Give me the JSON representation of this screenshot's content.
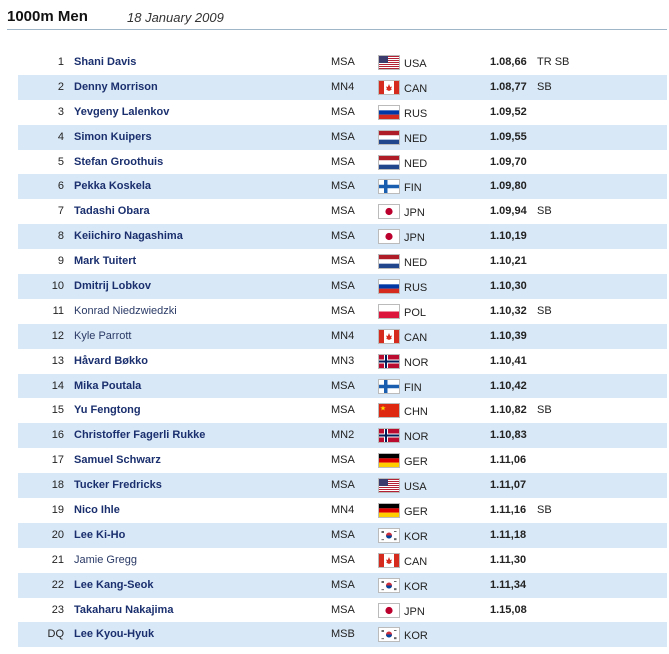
{
  "header": {
    "title": "1000m Men",
    "date": "18 January 2009"
  },
  "results": [
    {
      "rank": "1",
      "name": "Shani Davis",
      "division": "MSA",
      "country": "USA",
      "flag": "usa-flag",
      "time": "1.08,66",
      "note": "TR SB"
    },
    {
      "rank": "2",
      "name": "Denny Morrison",
      "division": "MN4",
      "country": "CAN",
      "flag": "can-flag",
      "time": "1.08,77",
      "note": "SB"
    },
    {
      "rank": "3",
      "name": "Yevgeny Lalenkov",
      "division": "MSA",
      "country": "RUS",
      "flag": "rus-flag",
      "time": "1.09,52",
      "note": ""
    },
    {
      "rank": "4",
      "name": "Simon Kuipers",
      "division": "MSA",
      "country": "NED",
      "flag": "ned-flag",
      "time": "1.09,55",
      "note": ""
    },
    {
      "rank": "5",
      "name": "Stefan Groothuis",
      "division": "MSA",
      "country": "NED",
      "flag": "ned-flag",
      "time": "1.09,70",
      "note": ""
    },
    {
      "rank": "6",
      "name": "Pekka Koskela",
      "division": "MSA",
      "country": "FIN",
      "flag": "fin-flag",
      "time": "1.09,80",
      "note": ""
    },
    {
      "rank": "7",
      "name": "Tadashi Obara",
      "division": "MSA",
      "country": "JPN",
      "flag": "jpn-flag",
      "time": "1.09,94",
      "note": "SB"
    },
    {
      "rank": "8",
      "name": "Keiichiro Nagashima",
      "division": "MSA",
      "country": "JPN",
      "flag": "jpn-flag",
      "time": "1.10,19",
      "note": ""
    },
    {
      "rank": "9",
      "name": "Mark Tuitert",
      "division": "MSA",
      "country": "NED",
      "flag": "ned-flag",
      "time": "1.10,21",
      "note": ""
    },
    {
      "rank": "10",
      "name": "Dmitrij Lobkov",
      "division": "MSA",
      "country": "RUS",
      "flag": "rus-flag",
      "time": "1.10,30",
      "note": ""
    },
    {
      "rank": "11",
      "name": "Konrad Niedzwiedzki",
      "division": "MSA",
      "country": "POL",
      "flag": "pol-flag",
      "time": "1.10,32",
      "note": "SB"
    },
    {
      "rank": "12",
      "name": "Kyle Parrott",
      "division": "MN4",
      "country": "CAN",
      "flag": "can-flag",
      "time": "1.10,39",
      "note": ""
    },
    {
      "rank": "13",
      "name": "Håvard Bøkko",
      "division": "MN3",
      "country": "NOR",
      "flag": "nor-flag",
      "time": "1.10,41",
      "note": ""
    },
    {
      "rank": "14",
      "name": "Mika Poutala",
      "division": "MSA",
      "country": "FIN",
      "flag": "fin-flag",
      "time": "1.10,42",
      "note": ""
    },
    {
      "rank": "15",
      "name": "Yu Fengtong",
      "division": "MSA",
      "country": "CHN",
      "flag": "chn-flag",
      "time": "1.10,82",
      "note": "SB"
    },
    {
      "rank": "16",
      "name": "Christoffer Fagerli Rukke",
      "division": "MN2",
      "country": "NOR",
      "flag": "nor-flag",
      "time": "1.10,83",
      "note": ""
    },
    {
      "rank": "17",
      "name": "Samuel Schwarz",
      "division": "MSA",
      "country": "GER",
      "flag": "ger-flag",
      "time": "1.11,06",
      "note": ""
    },
    {
      "rank": "18",
      "name": "Tucker Fredricks",
      "division": "MSA",
      "country": "USA",
      "flag": "usa-flag",
      "time": "1.11,07",
      "note": ""
    },
    {
      "rank": "19",
      "name": "Nico Ihle",
      "division": "MN4",
      "country": "GER",
      "flag": "ger-flag",
      "time": "1.11,16",
      "note": "SB"
    },
    {
      "rank": "20",
      "name": "Lee Ki-Ho",
      "division": "MSA",
      "country": "KOR",
      "flag": "kor-flag",
      "time": "1.11,18",
      "note": ""
    },
    {
      "rank": "21",
      "name": "Jamie Gregg",
      "division": "MSA",
      "country": "CAN",
      "flag": "can-flag",
      "time": "1.11,30",
      "note": ""
    },
    {
      "rank": "22",
      "name": "Lee Kang-Seok",
      "division": "MSA",
      "country": "KOR",
      "flag": "kor-flag",
      "time": "1.11,34",
      "note": ""
    },
    {
      "rank": "23",
      "name": "Takaharu Nakajima",
      "division": "MSA",
      "country": "JPN",
      "flag": "jpn-flag",
      "time": "1.15,08",
      "note": ""
    },
    {
      "rank": "DQ",
      "name": "Lee Kyou-Hyuk",
      "division": "MSB",
      "country": "KOR",
      "flag": "kor-flag",
      "time": "",
      "note": ""
    }
  ]
}
